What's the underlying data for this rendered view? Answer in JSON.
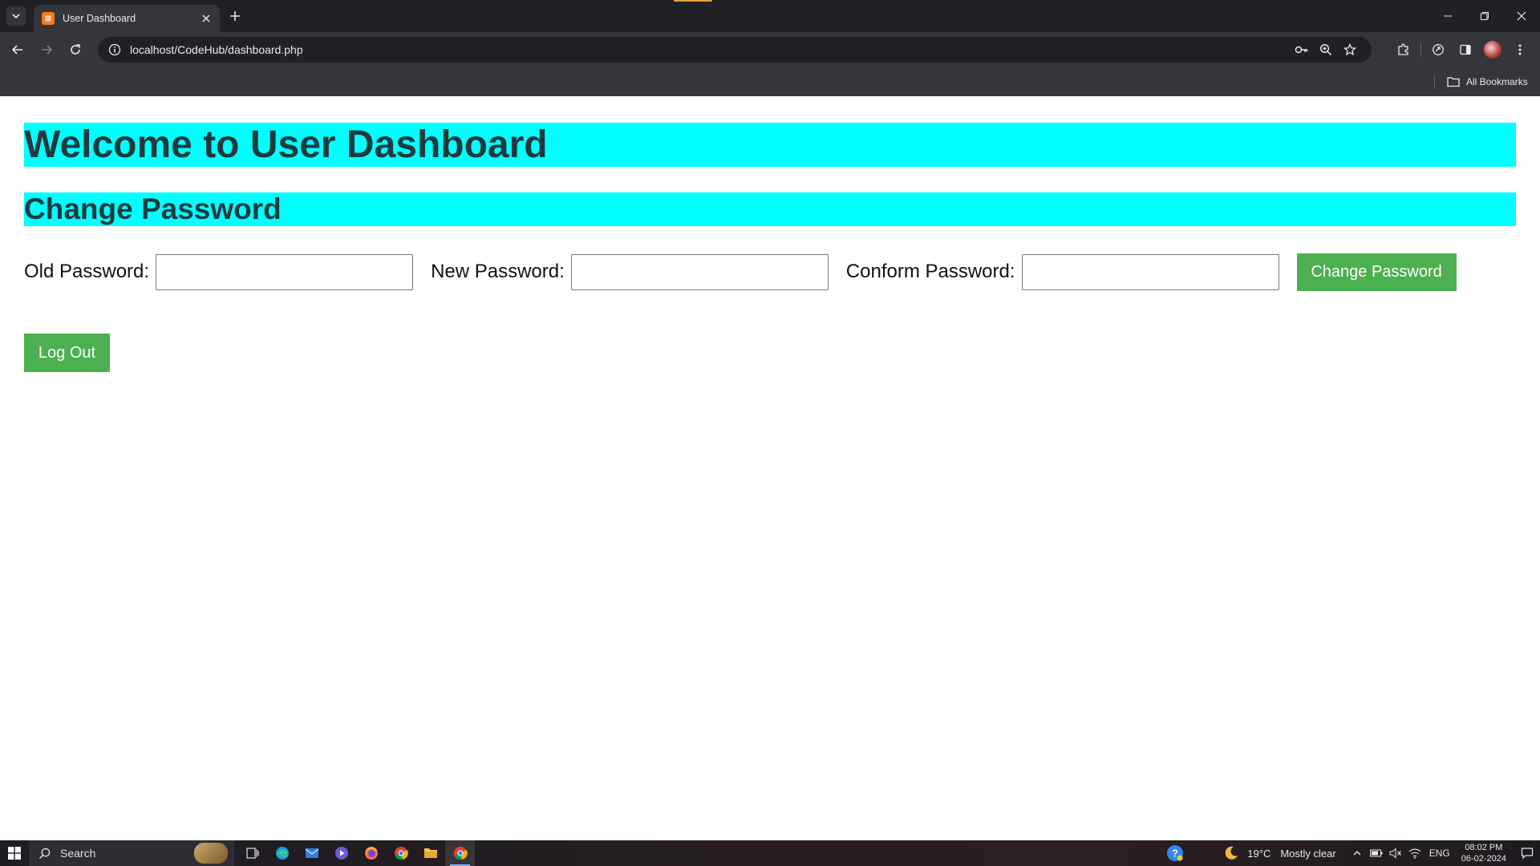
{
  "browser": {
    "tab_title": "User Dashboard",
    "url": "localhost/CodeHub/dashboard.php",
    "bookmarks_label": "All Bookmarks"
  },
  "page": {
    "heading": "Welcome to User Dashboard",
    "subheading": "Change Password",
    "form": {
      "old_password_label": "Old Password:",
      "old_password_value": "",
      "new_password_label": "New Password:",
      "new_password_value": "",
      "confirm_password_label": "Conform Password:",
      "confirm_password_value": "",
      "submit_label": "Change Password"
    },
    "logout_label": "Log Out"
  },
  "taskbar": {
    "search_label": "Search",
    "weather": "19°C",
    "weather_desc": "Mostly clear",
    "language": "ENG",
    "time": "08:02 PM",
    "date": "06-02-2024"
  },
  "colors": {
    "heading_bg": "#00ffff",
    "button_green": "#4caf50",
    "chrome_dark": "#202124",
    "chrome_toolbar": "#35363a"
  }
}
